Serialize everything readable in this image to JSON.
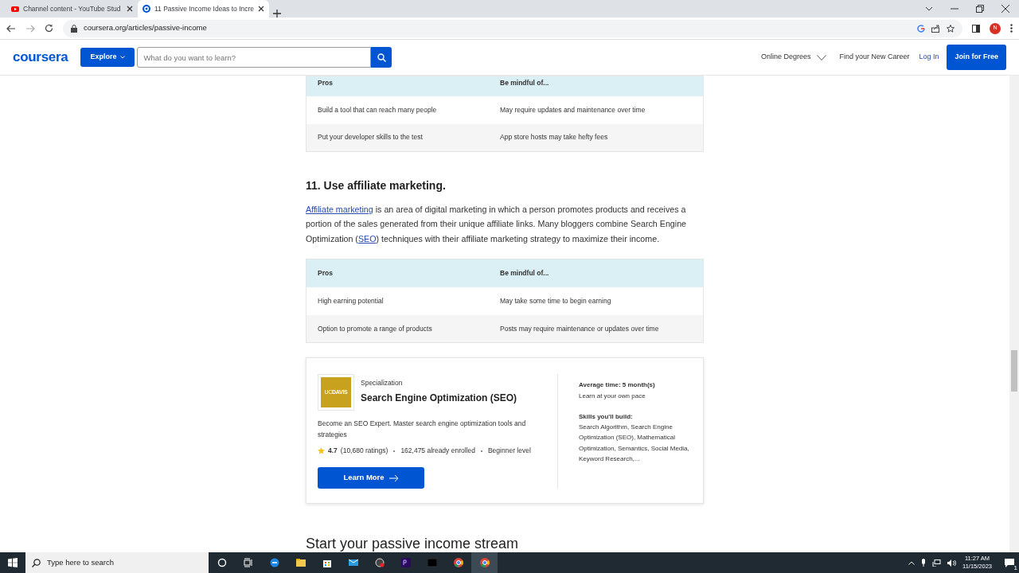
{
  "browser": {
    "tabs": [
      {
        "title": "Channel content - YouTube Stud",
        "selected": false,
        "kind": "youtube"
      },
      {
        "title": "11 Passive Income Ideas to Incre",
        "selected": true,
        "kind": "coursera"
      }
    ],
    "url": "coursera.org/articles/passive-income",
    "profile_initial": "N"
  },
  "header": {
    "logo": "coursera",
    "explore": "Explore",
    "search": {
      "placeholder": "What do you want to learn?"
    },
    "nav": [
      {
        "label": "Online Degrees",
        "kind": "dropdown"
      },
      {
        "label": "Find your New Career",
        "kind": "plain"
      },
      {
        "label": "Log In",
        "kind": "link"
      }
    ],
    "join": "Join for Free"
  },
  "article": [
    {
      "kind": "table",
      "columns": [
        "Pros",
        "Be mindful of..."
      ],
      "rows": [
        [
          "Build a tool that can reach many people",
          "May require updates and maintenance over time"
        ],
        [
          "Put your developer skills to the test",
          "App store hosts may take hefty fees"
        ]
      ]
    },
    {
      "kind": "heading",
      "text": "11. Use affiliate marketing."
    },
    {
      "kind": "paragraph",
      "parts": [
        {
          "text": "Affiliate marketing",
          "link": true
        },
        {
          "text": " is an area of digital marketing in which a person promotes products and receives a portion of the sales generated from their unique affiliate links. Many bloggers combine Search Engine Optimization (",
          "link": false
        },
        {
          "text": "SEO",
          "link": true
        },
        {
          "text": ") techniques with their affiliate marketing strategy to maximize their income.",
          "link": false
        }
      ]
    },
    {
      "kind": "table",
      "columns": [
        "Pros",
        "Be mindful of..."
      ],
      "rows": [
        [
          "High earning potential",
          "May take some time to begin earning"
        ],
        [
          "Option to promote a range of products",
          "Posts may require maintenance or updates over time"
        ]
      ]
    },
    {
      "kind": "course",
      "logo": [
        "UC",
        "DAVIS"
      ],
      "type": "Specialization",
      "title": "Search Engine Optimization (SEO)",
      "description": "Become an SEO Expert. Master search engine optimization tools and strategies",
      "rating": "4.7",
      "ratings": "(10,680 ratings)",
      "enrolled": "162,475 already enrolled",
      "level": "Beginner level",
      "button": "Learn More",
      "time_label": "Average time: 5 month(s)",
      "pace": "Learn at your own pace",
      "skills_label": "Skills you'll build:",
      "skills": "Search Algorithm, Search Engine Optimization (SEO), Mathematical Optimization, Semantics, Social Media, Keyword Research,..."
    },
    {
      "kind": "heading2",
      "text": "Start your passive income stream"
    }
  ],
  "taskbar": {
    "search_placeholder": "Type here to search",
    "time": "11:27 AM",
    "date": "11/15/2023",
    "notifications": "1"
  }
}
